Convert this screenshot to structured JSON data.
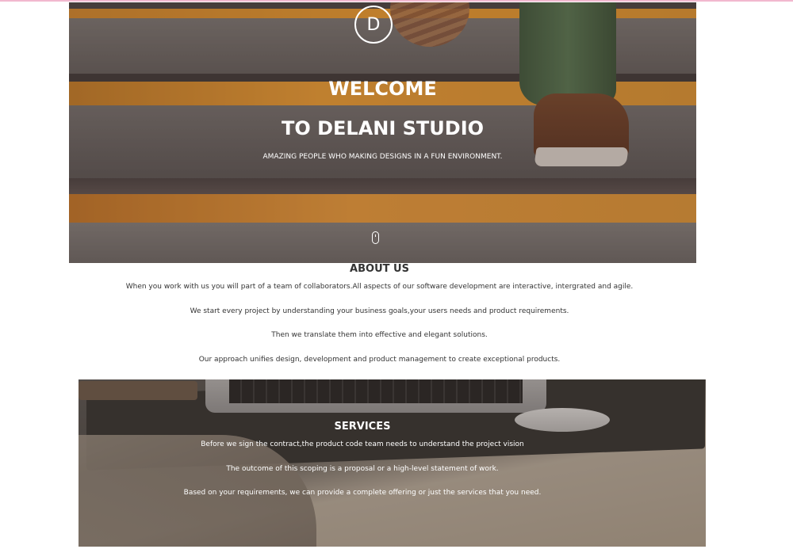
{
  "hero": {
    "logo_letter": "D",
    "title_line1": "WELCOME",
    "title_line2": "TO DELANI STUDIO",
    "subtitle": "AMAZING PEOPLE WHO MAKING DESIGNS IN A FUN ENVIRONMENT.",
    "scroll_icon": "mouse-icon"
  },
  "about": {
    "title": "ABOUT US",
    "paragraphs": [
      "When you work with us you will part of a team of collaborators.All aspects of our software development are interactive, intergrated and agile.",
      "We start every project by understanding your business goals,your users needs and product requirements.",
      "Then we translate them into effective and elegant solutions.",
      "Our approach unifies design, development and product management to create exceptional products."
    ]
  },
  "services": {
    "title": "SERVICES",
    "paragraphs": [
      "Before we sign the contract,the product code team needs to understand the project vision",
      "The outcome of this scoping is a proposal or a high-level statement of work.",
      "Based on your requirements, we can provide a complete offering or just the services that you need."
    ]
  },
  "colors": {
    "accent_orange": "#f2a12e",
    "text_dark": "#333333",
    "text_light": "#ffffff"
  }
}
